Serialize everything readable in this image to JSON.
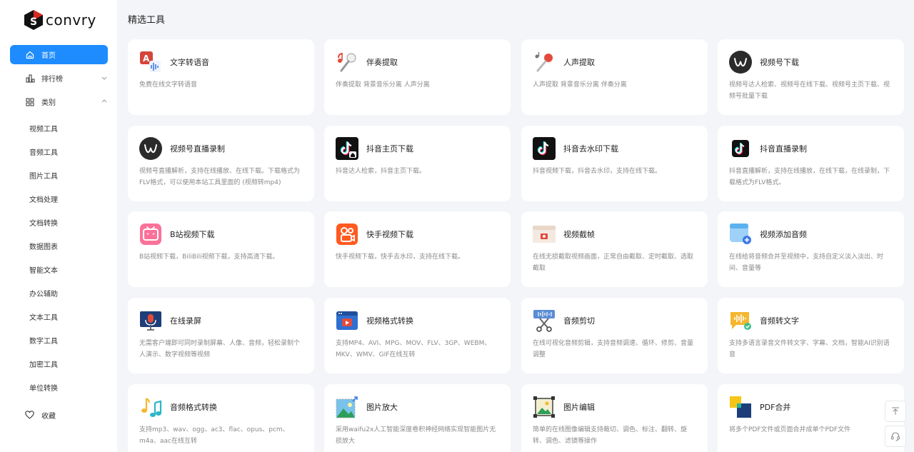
{
  "brand": {
    "name": "convry"
  },
  "sidebar": {
    "home": "首页",
    "ranking": "排行榜",
    "category": "类别",
    "sub_items": [
      "视频工具",
      "音频工具",
      "图片工具",
      "文档处理",
      "文档转换",
      "数据图表",
      "智能文本",
      "办公辅助",
      "文本工具",
      "数字工具",
      "加密工具",
      "单位转换"
    ],
    "favorites": "收藏"
  },
  "main": {
    "section_title": "精选工具",
    "cards": [
      {
        "title": "文字转语音",
        "desc": "免费在线文字转语音",
        "icon": "text-to-speech-icon"
      },
      {
        "title": "伴奏提取",
        "desc": "伴奏提取 背景音乐分离 人声分离",
        "icon": "accompaniment-icon"
      },
      {
        "title": "人声提取",
        "desc": "人声提取 背景音乐分离 伴奏分离",
        "icon": "vocal-icon"
      },
      {
        "title": "视频号下载",
        "desc": "视频号达人检索、视频号在线下载、视频号主页下载、视频号批量下载",
        "icon": "channels-icon"
      },
      {
        "title": "视频号直播录制",
        "desc": "视频号直播解析，支持在线播放、在线下载。下载格式为FLV格式，可以使用本站工具里面的 (视频转mp4)",
        "icon": "channels-icon"
      },
      {
        "title": "抖音主页下载",
        "desc": "抖音达人检索，抖音主页下载。",
        "icon": "douyin-home-icon"
      },
      {
        "title": "抖音去水印下载",
        "desc": "抖音视频下载，抖音去水印，支持在线下载。",
        "icon": "douyin-icon"
      },
      {
        "title": "抖音直播录制",
        "desc": "抖音直播解析，支持在线播放，在线下载，在线录制，下载格式为FLV格式。",
        "icon": "douyin-live-icon"
      },
      {
        "title": "B站视频下载",
        "desc": "B站视频下载，BiliBili视频下载，支持高清下载。",
        "icon": "bilibili-icon"
      },
      {
        "title": "快手视频下载",
        "desc": "快手视频下载，快手去水印，支持在线下载。",
        "icon": "kuaishou-icon"
      },
      {
        "title": "视频截帧",
        "desc": "在线无损截取视频画面，正常自由截取、定时截取、选取截取",
        "icon": "video-frame-icon"
      },
      {
        "title": "视频添加音频",
        "desc": "在线给将音频合并至视频中，支持自定义淡入淡出、时间、音量等",
        "icon": "video-add-audio-icon"
      },
      {
        "title": "在线录屏",
        "desc": "无需客户端即可同时录制屏幕、人像、音频，轻松录制个人演示、数字视频等视频",
        "icon": "screen-record-icon"
      },
      {
        "title": "视频格式转换",
        "desc": "支持MP4、AVI、MPG、MOV、FLV、3GP、WEBM、MKV、WMV、GIF在线互转",
        "icon": "video-convert-icon"
      },
      {
        "title": "音频剪切",
        "desc": "在线可视化音频剪辑，支持音频调速、循环、修剪、音量调整",
        "icon": "audio-cut-icon"
      },
      {
        "title": "音频转文字",
        "desc": "支持多语言录音文件转文字、字幕、文档，智能AI识别语音",
        "icon": "audio-to-text-icon"
      },
      {
        "title": "音频格式转换",
        "desc": "支持mp3、wav、ogg、ac3、flac、opus、pcm、m4a、aac在线互转",
        "icon": "music-note-icon"
      },
      {
        "title": "图片放大",
        "desc": "采用waifu2x人工智能深度卷积神经网络实现智能图片无损放大",
        "icon": "image-upscale-icon"
      },
      {
        "title": "图片编辑",
        "desc": "简单的在线图像编辑支持裁切、调色、标注、翻转、旋转、调色、滤镜等操作",
        "icon": "image-edit-icon"
      },
      {
        "title": "PDF合并",
        "desc": "将多个PDF文件或页面合并成单个PDF文件",
        "icon": "pdf-merge-icon"
      }
    ]
  },
  "colors": {
    "accent": "#1e8cff",
    "background": "#f3f5f8"
  }
}
